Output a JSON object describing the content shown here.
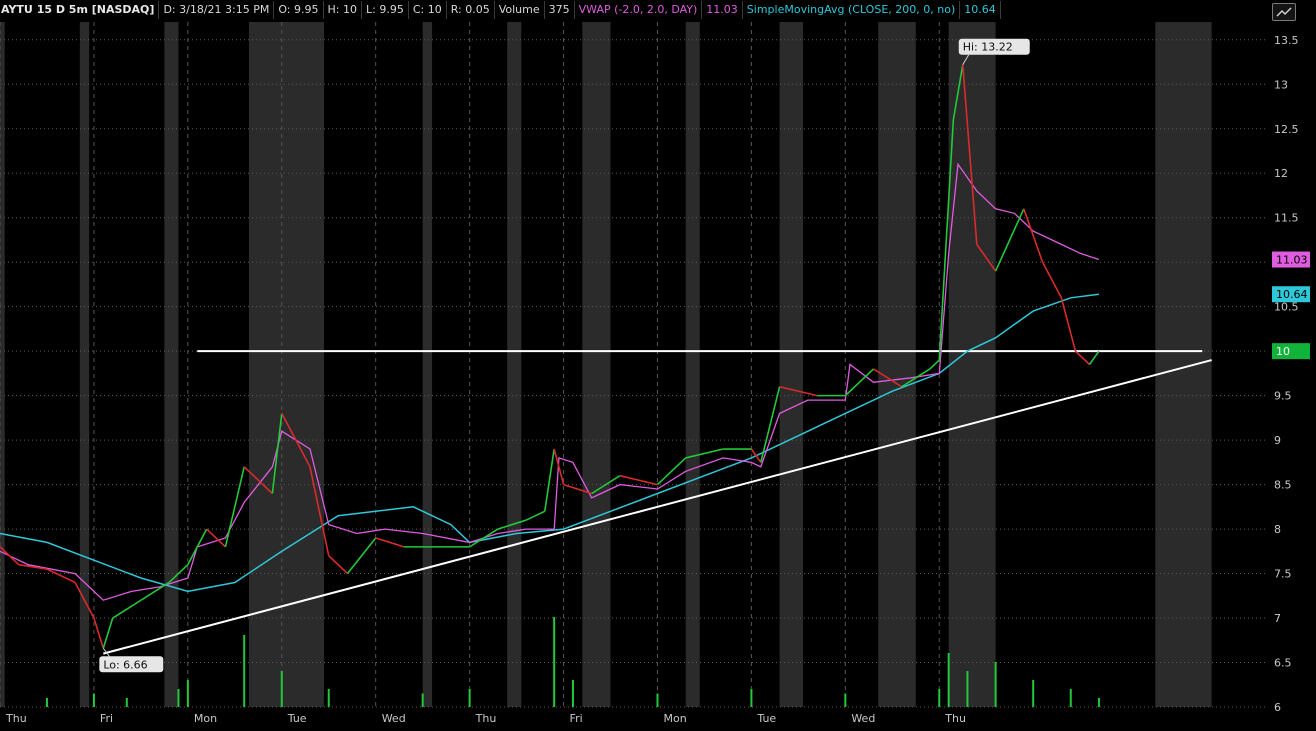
{
  "header": {
    "symbol": "AYTU 15 D 5m [NASDAQ]",
    "date": "D: 3/18/21 3:15 PM",
    "open": "O: 9.95",
    "high": "H: 10",
    "low": "L: 9.95",
    "close": "C: 10",
    "range": "R: 0.05",
    "volume_label": "Volume",
    "volume_value": "375",
    "vwap_label": "VWAP (-2.0, 2.0, DAY)",
    "vwap_value": "11.03",
    "sma_label": "SimpleMovingAvg (CLOSE, 200, 0, no)",
    "sma_value": "10.64"
  },
  "toggle_icon": "chart-expand-icon",
  "colors": {
    "background": "#000000",
    "session_shade": "#2b2b2b",
    "candle_up": "#22c93a",
    "candle_down": "#d92b2b",
    "vwap": "#e05ce0",
    "sma": "#2ec8d8",
    "trendline": "#ffffff",
    "last_price_badge": "#11b33a"
  },
  "chart_data": {
    "type": "line",
    "title": "AYTU 15 D 5m [NASDAQ]",
    "xlabel": "",
    "ylabel": "",
    "ylim": [
      6.0,
      13.7
    ],
    "grid": true,
    "y_ticks": [
      6,
      6.5,
      7,
      7.5,
      8,
      8.5,
      9,
      9.5,
      10,
      10.5,
      11,
      11.5,
      12,
      12.5,
      13,
      13.5
    ],
    "y_tick_labels": [
      "6",
      "6.5",
      "7",
      "7.5",
      "8",
      "8.5",
      "9",
      "9.5",
      "10",
      "10.5",
      "11",
      "11.5",
      "12",
      "12.5",
      "13",
      "13.5"
    ],
    "x_range": [
      0,
      13.5
    ],
    "x_ticks": [
      0,
      1,
      2,
      3,
      4,
      5,
      6,
      7,
      8,
      9,
      10,
      11
    ],
    "x_tick_labels": [
      "Thu",
      "Fri",
      "Mon",
      "Tue",
      "Wed",
      "Thu",
      "Fri",
      "Mon",
      "Tue",
      "Wed",
      "Thu"
    ],
    "price": [
      [
        0,
        7.8
      ],
      [
        0.2,
        7.6
      ],
      [
        0.5,
        7.55
      ],
      [
        0.8,
        7.4
      ],
      [
        1.0,
        7.0
      ],
      [
        1.1,
        6.66
      ],
      [
        1.2,
        7.0
      ],
      [
        1.5,
        7.2
      ],
      [
        1.8,
        7.4
      ],
      [
        2.0,
        7.6
      ],
      [
        2.2,
        8.0
      ],
      [
        2.4,
        7.8
      ],
      [
        2.6,
        8.7
      ],
      [
        2.9,
        8.4
      ],
      [
        3.0,
        9.3
      ],
      [
        3.3,
        8.7
      ],
      [
        3.5,
        7.7
      ],
      [
        3.7,
        7.5
      ],
      [
        4.0,
        7.9
      ],
      [
        4.3,
        7.8
      ],
      [
        4.6,
        7.8
      ],
      [
        5.0,
        7.8
      ],
      [
        5.3,
        8.0
      ],
      [
        5.6,
        8.1
      ],
      [
        5.8,
        8.2
      ],
      [
        5.9,
        8.9
      ],
      [
        6.0,
        8.5
      ],
      [
        6.3,
        8.4
      ],
      [
        6.6,
        8.6
      ],
      [
        7.0,
        8.5
      ],
      [
        7.3,
        8.8
      ],
      [
        7.7,
        8.9
      ],
      [
        8.0,
        8.9
      ],
      [
        8.1,
        8.75
      ],
      [
        8.3,
        9.6
      ],
      [
        8.7,
        9.5
      ],
      [
        9.0,
        9.5
      ],
      [
        9.3,
        9.8
      ],
      [
        9.6,
        9.6
      ],
      [
        9.9,
        9.8
      ],
      [
        10.0,
        9.9
      ],
      [
        10.15,
        12.6
      ],
      [
        10.25,
        13.22
      ],
      [
        10.4,
        11.2
      ],
      [
        10.6,
        10.9
      ],
      [
        10.9,
        11.6
      ],
      [
        11.1,
        11.0
      ],
      [
        11.3,
        10.6
      ],
      [
        11.45,
        10.0
      ],
      [
        11.6,
        9.85
      ],
      [
        11.7,
        10.0
      ]
    ],
    "vwap": [
      [
        0,
        7.75
      ],
      [
        0.3,
        7.6
      ],
      [
        0.8,
        7.5
      ],
      [
        1.1,
        7.2
      ],
      [
        1.4,
        7.3
      ],
      [
        1.7,
        7.35
      ],
      [
        2.0,
        7.45
      ],
      [
        2.1,
        7.8
      ],
      [
        2.4,
        7.9
      ],
      [
        2.6,
        8.3
      ],
      [
        2.9,
        8.7
      ],
      [
        3.0,
        9.1
      ],
      [
        3.3,
        8.9
      ],
      [
        3.5,
        8.05
      ],
      [
        3.8,
        7.95
      ],
      [
        4.1,
        8.0
      ],
      [
        4.5,
        7.95
      ],
      [
        5.0,
        7.85
      ],
      [
        5.3,
        7.95
      ],
      [
        5.6,
        8.0
      ],
      [
        5.9,
        8.0
      ],
      [
        5.95,
        8.8
      ],
      [
        6.1,
        8.75
      ],
      [
        6.3,
        8.35
      ],
      [
        6.6,
        8.5
      ],
      [
        7.0,
        8.45
      ],
      [
        7.3,
        8.65
      ],
      [
        7.7,
        8.8
      ],
      [
        8.0,
        8.75
      ],
      [
        8.1,
        8.7
      ],
      [
        8.3,
        9.3
      ],
      [
        8.6,
        9.45
      ],
      [
        9.0,
        9.45
      ],
      [
        9.05,
        9.85
      ],
      [
        9.3,
        9.65
      ],
      [
        9.7,
        9.7
      ],
      [
        10.0,
        9.75
      ],
      [
        10.1,
        11.1
      ],
      [
        10.2,
        12.1
      ],
      [
        10.4,
        11.8
      ],
      [
        10.6,
        11.6
      ],
      [
        10.8,
        11.55
      ],
      [
        11.0,
        11.35
      ],
      [
        11.3,
        11.2
      ],
      [
        11.5,
        11.1
      ],
      [
        11.7,
        11.03
      ]
    ],
    "sma": [
      [
        0,
        7.95
      ],
      [
        0.5,
        7.85
      ],
      [
        1.0,
        7.65
      ],
      [
        1.5,
        7.45
      ],
      [
        2.0,
        7.3
      ],
      [
        2.5,
        7.4
      ],
      [
        3.0,
        7.75
      ],
      [
        3.3,
        7.95
      ],
      [
        3.6,
        8.15
      ],
      [
        4.0,
        8.2
      ],
      [
        4.4,
        8.25
      ],
      [
        4.8,
        8.05
      ],
      [
        5.0,
        7.85
      ],
      [
        5.5,
        7.95
      ],
      [
        6.0,
        8.0
      ],
      [
        6.5,
        8.2
      ],
      [
        7.0,
        8.4
      ],
      [
        7.5,
        8.6
      ],
      [
        8.0,
        8.8
      ],
      [
        8.5,
        9.05
      ],
      [
        9.0,
        9.3
      ],
      [
        9.5,
        9.55
      ],
      [
        10.0,
        9.75
      ],
      [
        10.3,
        10.0
      ],
      [
        10.6,
        10.15
      ],
      [
        11.0,
        10.45
      ],
      [
        11.4,
        10.6
      ],
      [
        11.7,
        10.64
      ]
    ],
    "volume": [
      [
        0.5,
        0.1
      ],
      [
        1.0,
        0.15
      ],
      [
        1.35,
        0.1
      ],
      [
        1.9,
        0.2
      ],
      [
        2.0,
        0.3
      ],
      [
        2.6,
        0.8
      ],
      [
        3.0,
        0.4
      ],
      [
        3.5,
        0.2
      ],
      [
        4.5,
        0.15
      ],
      [
        5.0,
        0.2
      ],
      [
        5.9,
        1.0
      ],
      [
        6.1,
        0.3
      ],
      [
        7.0,
        0.15
      ],
      [
        8.0,
        0.2
      ],
      [
        9.0,
        0.15
      ],
      [
        10.0,
        0.2
      ],
      [
        10.1,
        0.6
      ],
      [
        10.3,
        0.4
      ],
      [
        10.6,
        0.5
      ],
      [
        11.0,
        0.3
      ],
      [
        11.4,
        0.2
      ],
      [
        11.7,
        0.1
      ]
    ],
    "resistance": {
      "x": [
        2.1,
        12.8
      ],
      "y": [
        10.0,
        10.0
      ]
    },
    "trendline": {
      "x": [
        1.1,
        12.9
      ],
      "y": [
        6.6,
        9.9
      ]
    },
    "annotations": {
      "hi": "Hi: 13.22",
      "lo": "Lo: 6.66"
    },
    "right_labels": [
      {
        "value": 11.03,
        "text": "11.03",
        "series": "vwap"
      },
      {
        "value": 10.64,
        "text": "10.64",
        "series": "sma"
      },
      {
        "value": 10.0,
        "text": "10",
        "series": "last"
      }
    ],
    "shaded_sessions": [
      [
        0,
        0.05
      ],
      [
        0.85,
        0.95
      ],
      [
        1.75,
        1.9
      ],
      [
        2.65,
        3.45
      ],
      [
        4.5,
        4.6
      ],
      [
        5.4,
        5.55
      ],
      [
        6.2,
        6.5
      ],
      [
        7.3,
        7.45
      ],
      [
        8.3,
        8.55
      ],
      [
        9.35,
        9.75
      ],
      [
        10.1,
        10.6
      ],
      [
        12.3,
        12.9
      ]
    ]
  }
}
